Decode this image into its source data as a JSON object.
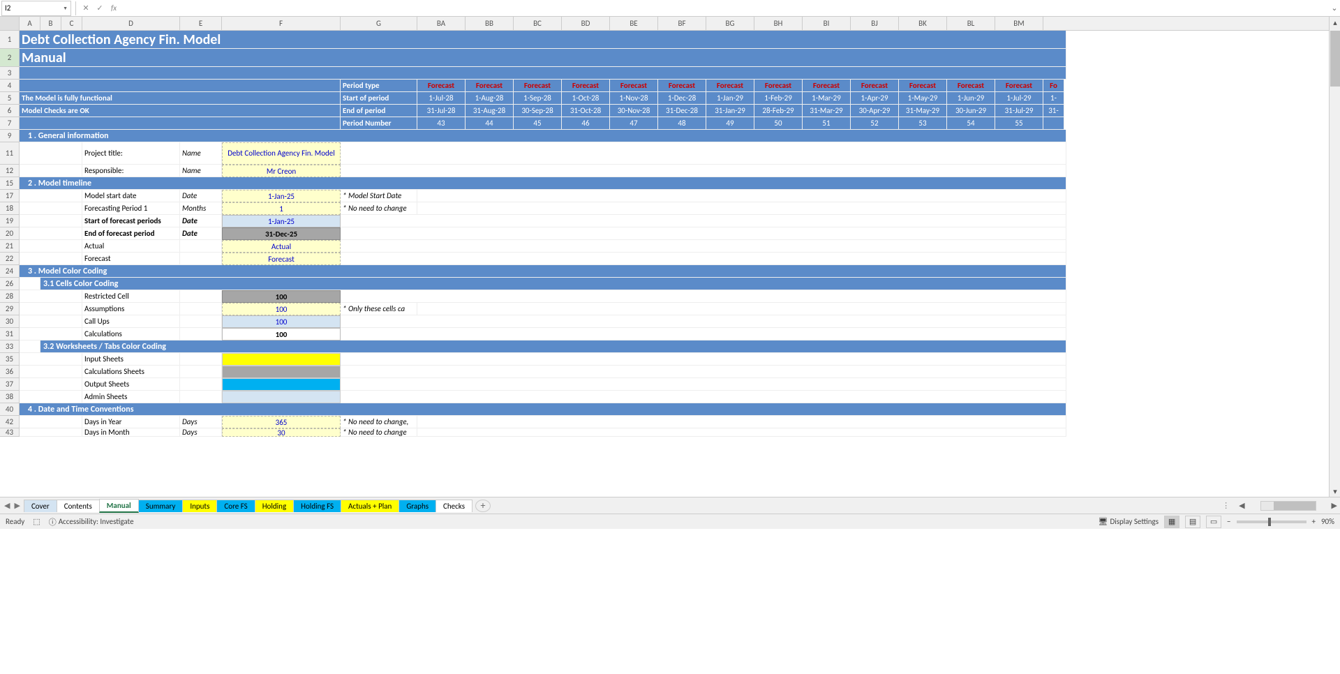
{
  "name_box": "I2",
  "fx_label": "fx",
  "columns": [
    "A",
    "B",
    "C",
    "D",
    "E",
    "F",
    "G",
    "BA",
    "BB",
    "BC",
    "BD",
    "BE",
    "BF",
    "BG",
    "BH",
    "BI",
    "BJ",
    "BK",
    "BL",
    "BM"
  ],
  "row_nums": [
    "1",
    "2",
    "3",
    "4",
    "5",
    "6",
    "7",
    "9",
    "11",
    "12",
    "15",
    "17",
    "18",
    "19",
    "20",
    "21",
    "22",
    "24",
    "26",
    "28",
    "29",
    "30",
    "31",
    "33",
    "35",
    "36",
    "37",
    "38",
    "40",
    "42",
    "43"
  ],
  "title": "Debt Collection Agency Fin. Model",
  "subtitle": "Manual",
  "status1": "The Model is fully functional",
  "status2": "Model Checks are OK",
  "period_labels": {
    "type": "Period type",
    "start": "Start of period",
    "end": "End of period",
    "num": "Period Number"
  },
  "forecast_label": "Forecast",
  "periods": [
    {
      "start": "1-Jul-28",
      "end": "31-Jul-28",
      "num": "43"
    },
    {
      "start": "1-Aug-28",
      "end": "31-Aug-28",
      "num": "44"
    },
    {
      "start": "1-Sep-28",
      "end": "30-Sep-28",
      "num": "45"
    },
    {
      "start": "1-Oct-28",
      "end": "31-Oct-28",
      "num": "46"
    },
    {
      "start": "1-Nov-28",
      "end": "30-Nov-28",
      "num": "47"
    },
    {
      "start": "1-Dec-28",
      "end": "31-Dec-28",
      "num": "48"
    },
    {
      "start": "1-Jan-29",
      "end": "31-Jan-29",
      "num": "49"
    },
    {
      "start": "1-Feb-29",
      "end": "28-Feb-29",
      "num": "50"
    },
    {
      "start": "1-Mar-29",
      "end": "31-Mar-29",
      "num": "51"
    },
    {
      "start": "1-Apr-29",
      "end": "30-Apr-29",
      "num": "52"
    },
    {
      "start": "1-May-29",
      "end": "31-May-29",
      "num": "53"
    },
    {
      "start": "1-Jun-29",
      "end": "30-Jun-29",
      "num": "54"
    },
    {
      "start": "1-Jul-29",
      "end": "31-Jul-29",
      "num": "55"
    }
  ],
  "extra_start": "1-",
  "extra_end": "31-",
  "extra_fc": "Fo",
  "sec1": "1 .  General information",
  "r11": {
    "label": "Project title:",
    "unit": "Name",
    "val": "Debt Collection Agency Fin. Model"
  },
  "r12": {
    "label": "Responsible:",
    "unit": "Name",
    "val": "Mr Creon"
  },
  "sec2": "2 .  Model timeline",
  "r17": {
    "label": "Model start date",
    "unit": "Date",
    "val": "1-Jan-25",
    "note": "* Model Start Date"
  },
  "r18": {
    "label": "Forecasting Period 1",
    "unit": "Months",
    "val": "1",
    "note": "* No need to change"
  },
  "r19": {
    "label": "Start of forecast periods",
    "unit": "Date",
    "val": "1-Jan-25"
  },
  "r20": {
    "label": "End of forecast period",
    "unit": "Date",
    "val": "31-Dec-25"
  },
  "r21": {
    "label": "Actual",
    "val": "Actual"
  },
  "r22": {
    "label": "Forecast",
    "val": "Forecast"
  },
  "sec3": "3 .  Model Color Coding",
  "sec31": "3.1 Cells Color Coding",
  "r28": {
    "label": "Restricted Cell",
    "val": "100"
  },
  "r29": {
    "label": "Assumptions",
    "val": "100",
    "note": "* Only these cells ca"
  },
  "r30": {
    "label": "Call Ups",
    "val": "100"
  },
  "r31": {
    "label": "Calculations",
    "val": "100"
  },
  "sec32": "3.2 Worksheets / Tabs Color Coding",
  "r35": {
    "label": "Input Sheets"
  },
  "r36": {
    "label": "Calculations Sheets"
  },
  "r37": {
    "label": "Output Sheets"
  },
  "r38": {
    "label": "Admin Sheets"
  },
  "sec4": "4 .  Date and Time Conventions",
  "r42": {
    "label": "Days in Year",
    "unit": "Days",
    "val": "365",
    "note": "* No need to change,"
  },
  "r43": {
    "label": "Days in Month",
    "unit": "Days",
    "val": "30",
    "note": "* No need to change"
  },
  "tabs": [
    {
      "name": "Cover",
      "cls": "ltblue"
    },
    {
      "name": "Contents",
      "cls": ""
    },
    {
      "name": "Manual",
      "cls": "active"
    },
    {
      "name": "Summary",
      "cls": "cyan"
    },
    {
      "name": "Inputs",
      "cls": "yellow"
    },
    {
      "name": "Core FS",
      "cls": "cyan"
    },
    {
      "name": "Holding",
      "cls": "yellow"
    },
    {
      "name": "Holding FS",
      "cls": "cyan"
    },
    {
      "name": "Actuals + Plan",
      "cls": "yellow"
    },
    {
      "name": "Graphs",
      "cls": "cyan"
    },
    {
      "name": "Checks",
      "cls": ""
    }
  ],
  "status": {
    "ready": "Ready",
    "acc": "Accessibility: Investigate",
    "disp": "Display Settings",
    "zoom": "90%"
  }
}
